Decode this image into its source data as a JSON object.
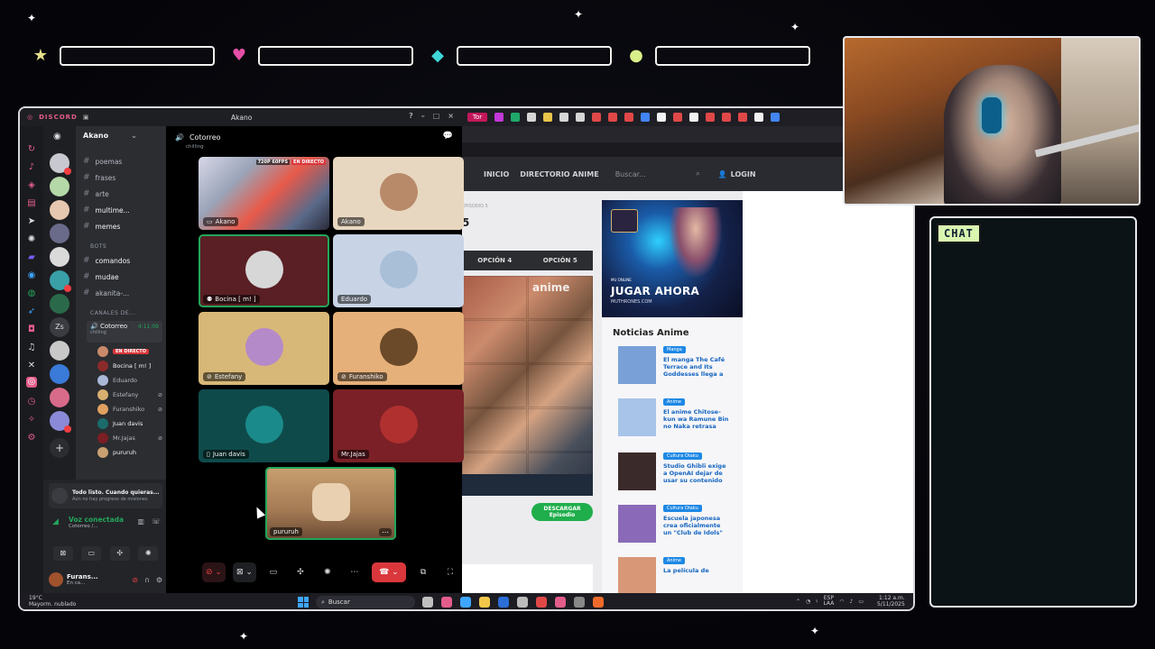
{
  "hud": {
    "slots": [
      {
        "icon": "star-icon",
        "glyph": "★",
        "color": "#e9e08b"
      },
      {
        "icon": "heart-icon",
        "glyph": "♥",
        "color": "#e44fa6"
      },
      {
        "icon": "diamond-icon",
        "glyph": "◆",
        "color": "#3fd6d8"
      },
      {
        "icon": "coin-icon",
        "glyph": "●",
        "color": "#d8ef8a"
      }
    ]
  },
  "discord": {
    "brand": "DISCORD",
    "server_header": "Akano",
    "server_name": "Akano",
    "channels": [
      {
        "name": "poemas",
        "prefix": "#"
      },
      {
        "name": "frases",
        "prefix": "#"
      },
      {
        "name": "arte",
        "prefix": "#"
      },
      {
        "name": "multime...",
        "prefix": "#"
      },
      {
        "name": "memes",
        "prefix": "#"
      }
    ],
    "category_bots": "BOTS",
    "bot_channels": [
      {
        "name": "comandos",
        "prefix": "#"
      },
      {
        "name": "mudae",
        "prefix": "#"
      },
      {
        "name": "akanita-...",
        "prefix": "#"
      }
    ],
    "category_voice": "CANALES DE...",
    "voice_channel": {
      "name": "Cotorreo",
      "timer": "4:11:09",
      "status": "chilling"
    },
    "voice_users": [
      {
        "name": "",
        "live": "EN DIRECTO",
        "color": "#c98a6a"
      },
      {
        "name": "Bocina [ m! ]",
        "color": "#8b2a2a"
      },
      {
        "name": "Eduardo",
        "color": "#aab8d8"
      },
      {
        "name": "Estefany",
        "color": "#d8b070"
      },
      {
        "name": "Furanshiko",
        "color": "#e0a060"
      },
      {
        "name": "Juan davis",
        "color": "#1b6b6b"
      },
      {
        "name": "Mr.Jajas",
        "color": "#7a1f24"
      },
      {
        "name": "pururuh",
        "color": "#c8a070"
      }
    ],
    "notice": {
      "title": "Todo listo. Cuando quieras...",
      "subtitle": "Aún no hay progreso de misiones"
    },
    "voice_connected": {
      "title": "Voz conectada",
      "sub": "Cotorreo /..."
    },
    "user": {
      "name": "Furans...",
      "status": "En ca..."
    },
    "stage": {
      "server": "Akano",
      "channel": "Cotorreo",
      "status": "chilling",
      "tiles": [
        {
          "name": "Akano",
          "kind": "stream",
          "quality": "720P 60FPS",
          "live": "EN DIRECTO"
        },
        {
          "name": "Akano",
          "kind": "avatar",
          "bg": "#e8d7c0",
          "avatar": "#b88a6a"
        },
        {
          "name": "Bocina [ m! ]",
          "kind": "avatar",
          "bg": "#5a1f24",
          "avatar": "#d7d7d7",
          "speaking": true
        },
        {
          "name": "Eduardo",
          "kind": "avatar",
          "bg": "#c8d4e6",
          "avatar": "#a9bfd8"
        },
        {
          "name": "Estefany",
          "kind": "avatar",
          "bg": "#d8b878",
          "avatar": "#b58ac8"
        },
        {
          "name": "Furanshiko",
          "kind": "avatar",
          "bg": "#e6b07a",
          "avatar": "#6b4a2a"
        },
        {
          "name": "Juan davis",
          "kind": "avatar",
          "bg": "#0f4a4a",
          "avatar": "#1a8a8a"
        },
        {
          "name": "Mr.Jajas",
          "kind": "avatar",
          "bg": "#7a2026",
          "avatar": "#b03030"
        },
        {
          "name": "pururuh",
          "kind": "video",
          "bg": "#b88a60"
        }
      ]
    }
  },
  "browser": {
    "active_tab": "Tor",
    "nav": {
      "home": "INICIO",
      "directory": "DIRECTORIO ANIME",
      "search_placeholder": "Buscar...",
      "login": "LOGIN"
    },
    "page": {
      "episode_tiny": "EPISODIO 5",
      "episode_number": "5",
      "options": [
        "OPCIÓN 4",
        "OPCIÓN 5"
      ],
      "video_logo": "anime",
      "download": {
        "label": "DESCARGAR",
        "sub": "Episodio"
      },
      "ad": {
        "cta": "JUGAR AHORA",
        "site": "MUTHRONES.COM",
        "chip": "MU ONLINE"
      },
      "news_title": "Noticias Anime",
      "news": [
        {
          "tag": "Manga",
          "text": "El manga The Café Terrace and Its Goddesses llega a",
          "thumb": "#7aa0d8"
        },
        {
          "tag": "Anime",
          "text": "El anime Chitose-kun wa Ramune Bin no Naka retrasa",
          "thumb": "#a8c4e8"
        },
        {
          "tag": "Cultura Otaku",
          "text": "Studio Ghibli exige a OpenAI dejar de usar su contenido",
          "thumb": "#3a2a2a"
        },
        {
          "tag": "Cultura Otaku",
          "text": "Escuela japonesa crea oficialmente un \"Club de Idols\"",
          "thumb": "#8a6ab8"
        },
        {
          "tag": "Anime",
          "text": "La película de",
          "thumb": "#d89878"
        }
      ]
    }
  },
  "taskbar": {
    "temp": "19°C",
    "weather": "Mayorm. nublado",
    "search": "Buscar",
    "lang1": "ESP",
    "lang2": "LAA",
    "time": "1:12 a.m.",
    "date": "5/11/2025"
  },
  "chat": {
    "label": "CHAT"
  }
}
